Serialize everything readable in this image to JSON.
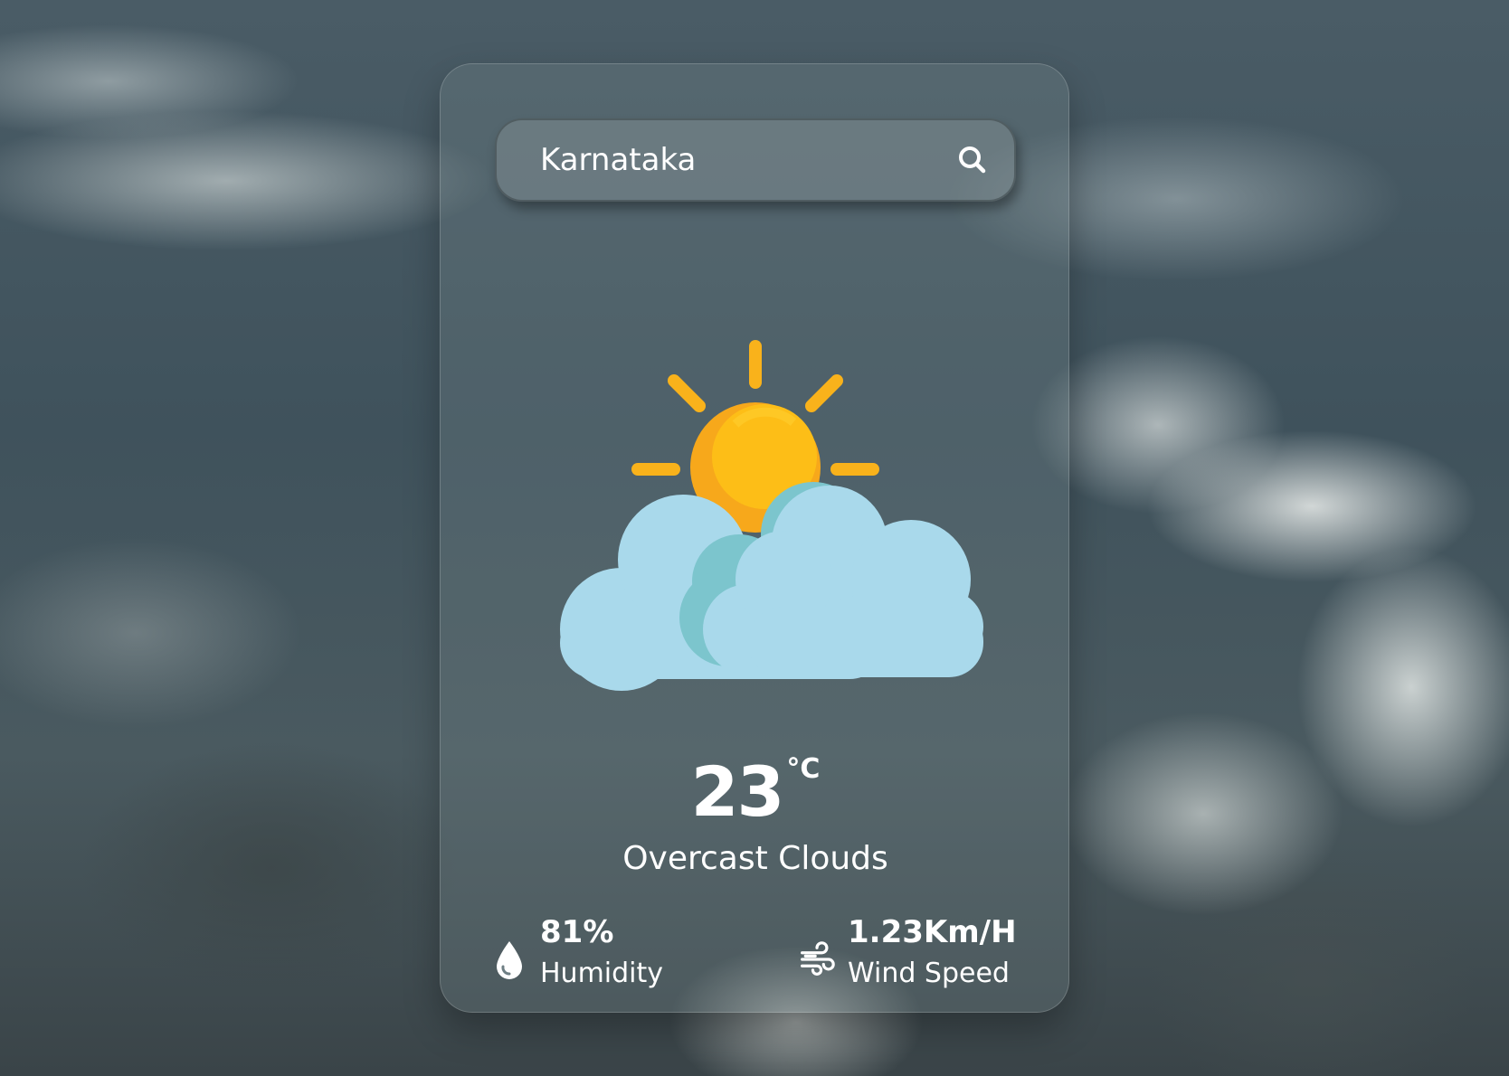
{
  "search": {
    "value": "Karnataka",
    "icon": "search-icon"
  },
  "weather": {
    "icon": "partly-cloudy-icon",
    "temperature": "23",
    "unit": "°C",
    "condition": "Overcast Clouds"
  },
  "humidity": {
    "icon": "water-drop-icon",
    "value": "81%",
    "label": "Humidity"
  },
  "wind": {
    "icon": "wind-icon",
    "value": "1.23Km/H",
    "label": "Wind Speed"
  },
  "colors": {
    "sun": "#fbb21a",
    "sun_rays": "#f9b21b",
    "cloud": "#a8d8ea",
    "cloud_shadow": "#7cc4cc",
    "text": "#ffffff"
  }
}
